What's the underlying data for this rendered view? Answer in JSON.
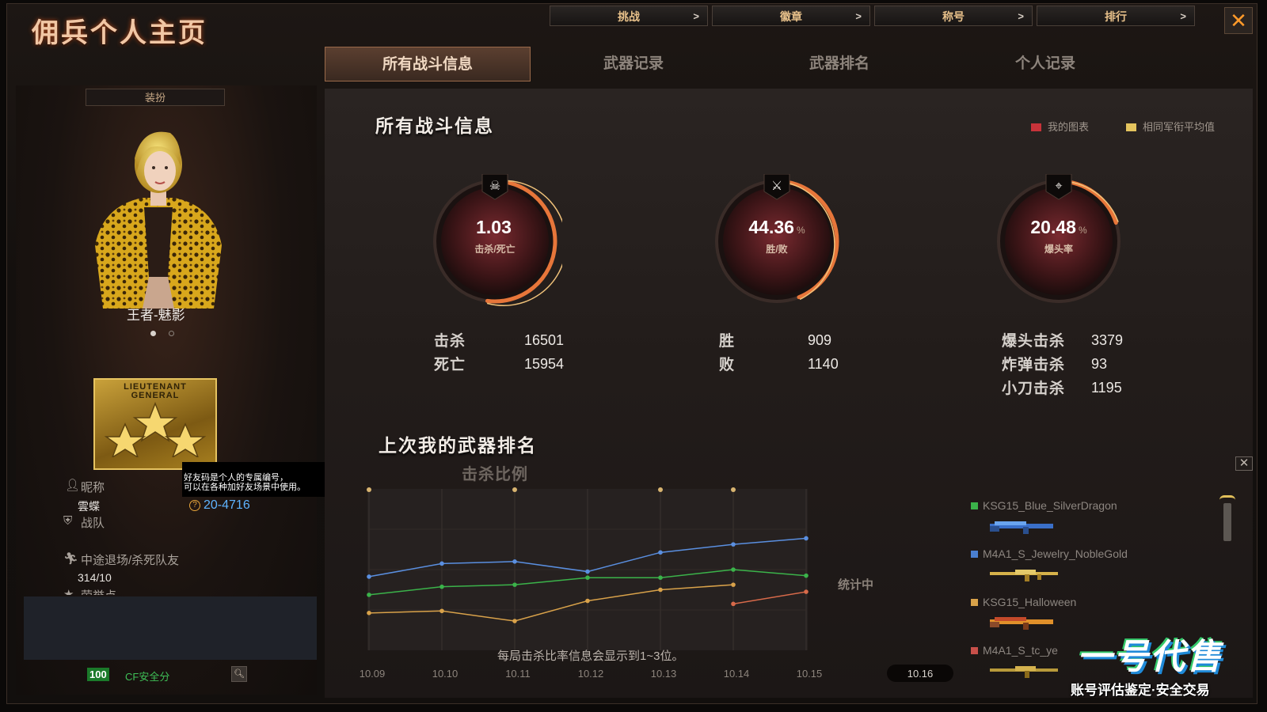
{
  "window": {
    "title": "佣兵个人主页",
    "close_label": "✕"
  },
  "top_nav": [
    {
      "label": "挑战",
      "arrow": ">"
    },
    {
      "label": "徽章",
      "arrow": ">"
    },
    {
      "label": "称号",
      "arrow": ">"
    },
    {
      "label": "排行",
      "arrow": ">"
    }
  ],
  "tabs": [
    {
      "label": "所有战斗信息",
      "active": true
    },
    {
      "label": "武器记录",
      "active": false
    },
    {
      "label": "武器排名",
      "active": false
    },
    {
      "label": "个人记录",
      "active": false
    }
  ],
  "left": {
    "dress_button": "装扮",
    "character_name": "王者-魅影",
    "rank_badge_text": [
      "LIEUTENANT",
      "GENERAL"
    ],
    "tooltip_lines": [
      "好友码是个人的专属编号，",
      "可以在各种加好友场景中使用。"
    ],
    "nickname_label": "昵称",
    "nickname_value": "雲蝶",
    "friend_code": "20-4716",
    "team_label": "战队",
    "quit_label": "中途退场/杀死队友",
    "quit_value": "314/10",
    "praise_label": "荣誉点",
    "safety_score": "100",
    "safety_label": "CF安全分"
  },
  "main": {
    "section_title": "所有战斗信息",
    "legend": [
      {
        "label": "我的图表",
        "color": "#c8333a"
      },
      {
        "label": "相同军衔平均值",
        "color": "#e4c45e"
      }
    ],
    "gauges": [
      {
        "value": "1.03",
        "unit": "",
        "caption": "击杀/死亡",
        "icon": "skull-icon",
        "fraction": 0.52
      },
      {
        "value": "44.36",
        "unit": "%",
        "caption": "胜/败",
        "icon": "crossed-guns-icon",
        "fraction": 0.44
      },
      {
        "value": "20.48",
        "unit": "%",
        "caption": "爆头率",
        "icon": "headshot-icon",
        "fraction": 0.2
      }
    ],
    "stats_a": [
      {
        "label": "击杀",
        "value": "16501"
      },
      {
        "label": "死亡",
        "value": "15954"
      }
    ],
    "stats_b": [
      {
        "label": "胜",
        "value": "909"
      },
      {
        "label": "败",
        "value": "1140"
      }
    ],
    "stats_c": [
      {
        "label": "爆头击杀",
        "value": "3379"
      },
      {
        "label": "炸弹击杀",
        "value": "93"
      },
      {
        "label": "小刀击杀",
        "value": "1195"
      }
    ],
    "weapon_rank_title": "上次我的武器排名",
    "kill_ratio_label": "击杀比例",
    "counting_label": "统计中",
    "chart_note": "每局击杀比率信息会显示到1~3位。",
    "weapons": [
      {
        "name": "KSG15_Blue_SilverDragon",
        "color": "#3bb34a"
      },
      {
        "name": "M4A1_S_Jewelry_NobleGold",
        "color": "#4a7fd0"
      },
      {
        "name": "KSG15_Halloween",
        "color": "#d9a24a"
      },
      {
        "name": "M4A1_S_tc_ye",
        "color": "#c8504a"
      }
    ]
  },
  "watermark": {
    "logo": "一号代售",
    "slogan": "账号评估鉴定·安全交易"
  },
  "chart_data": {
    "type": "line",
    "categories": [
      "10.09",
      "10.10",
      "10.11",
      "10.12",
      "10.13",
      "10.14",
      "10.15",
      "10.16"
    ],
    "selected_category": "10.16",
    "series": [
      {
        "name": "KSG15_Blue_SilverDragon",
        "color": "#3bb34a",
        "values": [
          0.55,
          0.63,
          0.65,
          0.72,
          0.72,
          0.8,
          0.74,
          null
        ]
      },
      {
        "name": "M4A1_S_Jewelry_NobleGold",
        "color": "#5a8fe0",
        "values": [
          0.73,
          0.86,
          0.88,
          0.78,
          0.97,
          1.05,
          1.11,
          null
        ]
      },
      {
        "name": "KSG15_Halloween",
        "color": "#d9a24a",
        "values": [
          0.37,
          0.39,
          0.29,
          0.49,
          0.6,
          0.65,
          null,
          null
        ]
      },
      {
        "name": "M4A1_S_tc_ye",
        "color": "#d86a4a",
        "values": [
          null,
          null,
          null,
          null,
          null,
          0.46,
          0.58,
          null
        ]
      }
    ],
    "markers": [
      "10.09",
      "10.11",
      "10.13",
      "10.14"
    ],
    "ylim": [
      0,
      1.6
    ],
    "grid": true
  }
}
